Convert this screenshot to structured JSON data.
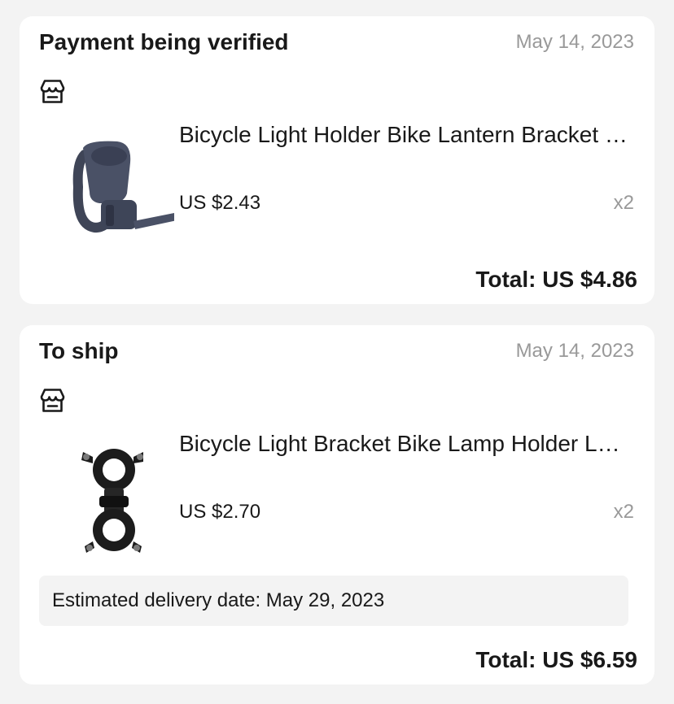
{
  "orders": [
    {
      "status": "Payment being verified",
      "date": "May 14, 2023",
      "store_icon": "store-icon",
      "item": {
        "title": "Bicycle Light Holder Bike Lantern Bracket Flashlight Clip",
        "price": "US $2.43",
        "quantity": "x2",
        "image": "bike-light-holder-clamp"
      },
      "total": "Total: US $4.86"
    },
    {
      "status": "To ship",
      "date": "May 14, 2023",
      "store_icon": "store-icon",
      "item": {
        "title": "Bicycle Light Bracket Bike Lamp Holder LED Torch Clip",
        "price": "US $2.70",
        "quantity": "x2",
        "image": "bike-lamp-bracket-double"
      },
      "delivery": "Estimated delivery date: May 29, 2023",
      "total": "Total: US $6.59"
    }
  ],
  "colors": {
    "background": "#f3f3f3",
    "card": "#ffffff",
    "text_primary": "#191919",
    "text_secondary": "#999999"
  }
}
